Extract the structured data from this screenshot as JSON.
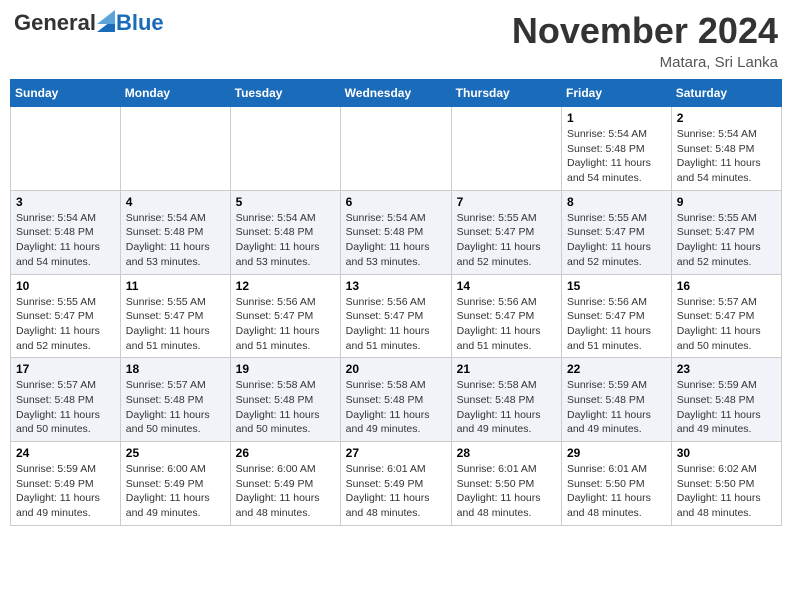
{
  "header": {
    "logo_general": "General",
    "logo_blue": "Blue",
    "month_title": "November 2024",
    "location": "Matara, Sri Lanka"
  },
  "weekdays": [
    "Sunday",
    "Monday",
    "Tuesday",
    "Wednesday",
    "Thursday",
    "Friday",
    "Saturday"
  ],
  "weeks": [
    {
      "days": [
        {
          "num": "",
          "info": ""
        },
        {
          "num": "",
          "info": ""
        },
        {
          "num": "",
          "info": ""
        },
        {
          "num": "",
          "info": ""
        },
        {
          "num": "",
          "info": ""
        },
        {
          "num": "1",
          "info": "Sunrise: 5:54 AM\nSunset: 5:48 PM\nDaylight: 11 hours\nand 54 minutes."
        },
        {
          "num": "2",
          "info": "Sunrise: 5:54 AM\nSunset: 5:48 PM\nDaylight: 11 hours\nand 54 minutes."
        }
      ]
    },
    {
      "days": [
        {
          "num": "3",
          "info": "Sunrise: 5:54 AM\nSunset: 5:48 PM\nDaylight: 11 hours\nand 54 minutes."
        },
        {
          "num": "4",
          "info": "Sunrise: 5:54 AM\nSunset: 5:48 PM\nDaylight: 11 hours\nand 53 minutes."
        },
        {
          "num": "5",
          "info": "Sunrise: 5:54 AM\nSunset: 5:48 PM\nDaylight: 11 hours\nand 53 minutes."
        },
        {
          "num": "6",
          "info": "Sunrise: 5:54 AM\nSunset: 5:48 PM\nDaylight: 11 hours\nand 53 minutes."
        },
        {
          "num": "7",
          "info": "Sunrise: 5:55 AM\nSunset: 5:47 PM\nDaylight: 11 hours\nand 52 minutes."
        },
        {
          "num": "8",
          "info": "Sunrise: 5:55 AM\nSunset: 5:47 PM\nDaylight: 11 hours\nand 52 minutes."
        },
        {
          "num": "9",
          "info": "Sunrise: 5:55 AM\nSunset: 5:47 PM\nDaylight: 11 hours\nand 52 minutes."
        }
      ]
    },
    {
      "days": [
        {
          "num": "10",
          "info": "Sunrise: 5:55 AM\nSunset: 5:47 PM\nDaylight: 11 hours\nand 52 minutes."
        },
        {
          "num": "11",
          "info": "Sunrise: 5:55 AM\nSunset: 5:47 PM\nDaylight: 11 hours\nand 51 minutes."
        },
        {
          "num": "12",
          "info": "Sunrise: 5:56 AM\nSunset: 5:47 PM\nDaylight: 11 hours\nand 51 minutes."
        },
        {
          "num": "13",
          "info": "Sunrise: 5:56 AM\nSunset: 5:47 PM\nDaylight: 11 hours\nand 51 minutes."
        },
        {
          "num": "14",
          "info": "Sunrise: 5:56 AM\nSunset: 5:47 PM\nDaylight: 11 hours\nand 51 minutes."
        },
        {
          "num": "15",
          "info": "Sunrise: 5:56 AM\nSunset: 5:47 PM\nDaylight: 11 hours\nand 51 minutes."
        },
        {
          "num": "16",
          "info": "Sunrise: 5:57 AM\nSunset: 5:47 PM\nDaylight: 11 hours\nand 50 minutes."
        }
      ]
    },
    {
      "days": [
        {
          "num": "17",
          "info": "Sunrise: 5:57 AM\nSunset: 5:48 PM\nDaylight: 11 hours\nand 50 minutes."
        },
        {
          "num": "18",
          "info": "Sunrise: 5:57 AM\nSunset: 5:48 PM\nDaylight: 11 hours\nand 50 minutes."
        },
        {
          "num": "19",
          "info": "Sunrise: 5:58 AM\nSunset: 5:48 PM\nDaylight: 11 hours\nand 50 minutes."
        },
        {
          "num": "20",
          "info": "Sunrise: 5:58 AM\nSunset: 5:48 PM\nDaylight: 11 hours\nand 49 minutes."
        },
        {
          "num": "21",
          "info": "Sunrise: 5:58 AM\nSunset: 5:48 PM\nDaylight: 11 hours\nand 49 minutes."
        },
        {
          "num": "22",
          "info": "Sunrise: 5:59 AM\nSunset: 5:48 PM\nDaylight: 11 hours\nand 49 minutes."
        },
        {
          "num": "23",
          "info": "Sunrise: 5:59 AM\nSunset: 5:48 PM\nDaylight: 11 hours\nand 49 minutes."
        }
      ]
    },
    {
      "days": [
        {
          "num": "24",
          "info": "Sunrise: 5:59 AM\nSunset: 5:49 PM\nDaylight: 11 hours\nand 49 minutes."
        },
        {
          "num": "25",
          "info": "Sunrise: 6:00 AM\nSunset: 5:49 PM\nDaylight: 11 hours\nand 49 minutes."
        },
        {
          "num": "26",
          "info": "Sunrise: 6:00 AM\nSunset: 5:49 PM\nDaylight: 11 hours\nand 48 minutes."
        },
        {
          "num": "27",
          "info": "Sunrise: 6:01 AM\nSunset: 5:49 PM\nDaylight: 11 hours\nand 48 minutes."
        },
        {
          "num": "28",
          "info": "Sunrise: 6:01 AM\nSunset: 5:50 PM\nDaylight: 11 hours\nand 48 minutes."
        },
        {
          "num": "29",
          "info": "Sunrise: 6:01 AM\nSunset: 5:50 PM\nDaylight: 11 hours\nand 48 minutes."
        },
        {
          "num": "30",
          "info": "Sunrise: 6:02 AM\nSunset: 5:50 PM\nDaylight: 11 hours\nand 48 minutes."
        }
      ]
    }
  ]
}
